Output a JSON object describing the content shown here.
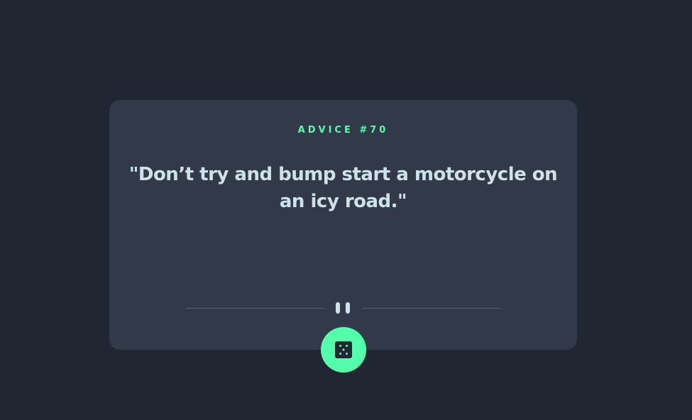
{
  "advice": {
    "label": "ADVICE #70",
    "text": "\"Don’t try and bump start a motorcycle on an icy road.\""
  },
  "icons": {
    "divider": "pause-icon",
    "button": "dice-icon"
  },
  "colors": {
    "background": "#202632",
    "card": "#323a49",
    "accent": "#53ffaa",
    "text": "#cee3e9",
    "divider": "#4f5d74"
  }
}
